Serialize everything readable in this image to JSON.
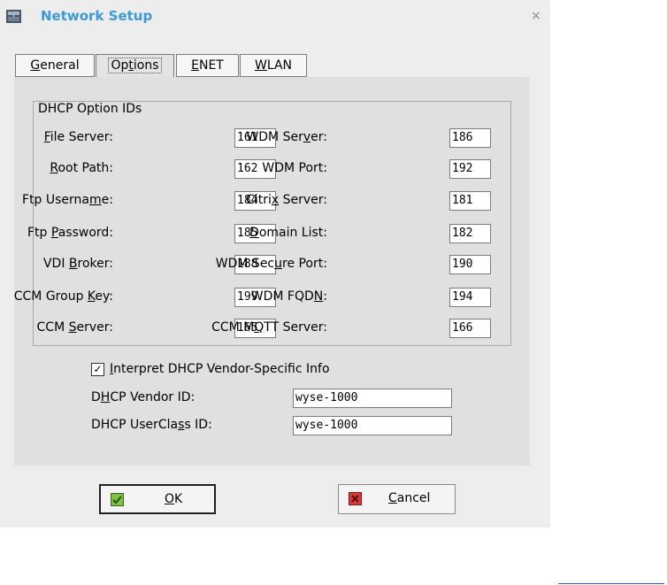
{
  "window": {
    "title": "Network Setup",
    "close_glyph": "×"
  },
  "tabs": [
    {
      "pre": "",
      "u": "G",
      "post": "eneral"
    },
    {
      "pre": "Op",
      "u": "t",
      "post": "ions"
    },
    {
      "pre": "",
      "u": "E",
      "post": "NET"
    },
    {
      "pre": "",
      "u": "W",
      "post": "LAN"
    }
  ],
  "group": {
    "title": "DHCP Option IDs"
  },
  "left_fields": [
    {
      "pre": "",
      "u": "F",
      "post": "ile Server:",
      "value": "161"
    },
    {
      "pre": "",
      "u": "R",
      "post": "oot Path:",
      "value": "162"
    },
    {
      "pre": "Ftp Userna",
      "u": "m",
      "post": "e:",
      "value": "184"
    },
    {
      "pre": "Ftp ",
      "u": "P",
      "post": "assword:",
      "value": "185"
    },
    {
      "pre": "VDI ",
      "u": "B",
      "post": "roker:",
      "value": "188"
    },
    {
      "pre": "CCM Group ",
      "u": "K",
      "post": "ey:",
      "value": "199"
    },
    {
      "pre": "CCM ",
      "u": "S",
      "post": "erver:",
      "value": "165"
    }
  ],
  "right_fields": [
    {
      "pre": "WDM Ser",
      "u": "v",
      "post": "er:",
      "value": "186"
    },
    {
      "pre": "WDM Port:",
      "u": "",
      "post": "",
      "value": "192"
    },
    {
      "pre": "Citri",
      "u": "x",
      "post": " Server:",
      "value": "181"
    },
    {
      "pre": "",
      "u": "D",
      "post": "omain List:",
      "value": "182"
    },
    {
      "pre": "WDM Sec",
      "u": "u",
      "post": "re Port:",
      "value": "190"
    },
    {
      "pre": "WDM FQD",
      "u": "N",
      "post": ":",
      "value": "194"
    },
    {
      "pre": "CCM M",
      "u": "Q",
      "post": "TT Server:",
      "value": "166"
    }
  ],
  "vendor": {
    "checkbox_mark": "✓",
    "checkbox_checked": true,
    "checkbox_pre": "",
    "checkbox_u": "I",
    "checkbox_post": "nterpret DHCP Vendor-Specific Info",
    "vendor_id_pre": "D",
    "vendor_id_u": "H",
    "vendor_id_post": "CP Vendor ID:",
    "vendor_id_value": "wyse-1000",
    "userclass_pre": "DHCP UserCla",
    "userclass_u": "s",
    "userclass_post": "s ID:",
    "userclass_value": "wyse-1000"
  },
  "buttons": {
    "ok_u": "O",
    "ok_post": "K",
    "cancel_u": "C",
    "cancel_post": "ancel"
  },
  "colors": {
    "title": "#3a9ad9",
    "ok_icon": "#7cc242",
    "cancel_icon": "#d83a3a"
  }
}
